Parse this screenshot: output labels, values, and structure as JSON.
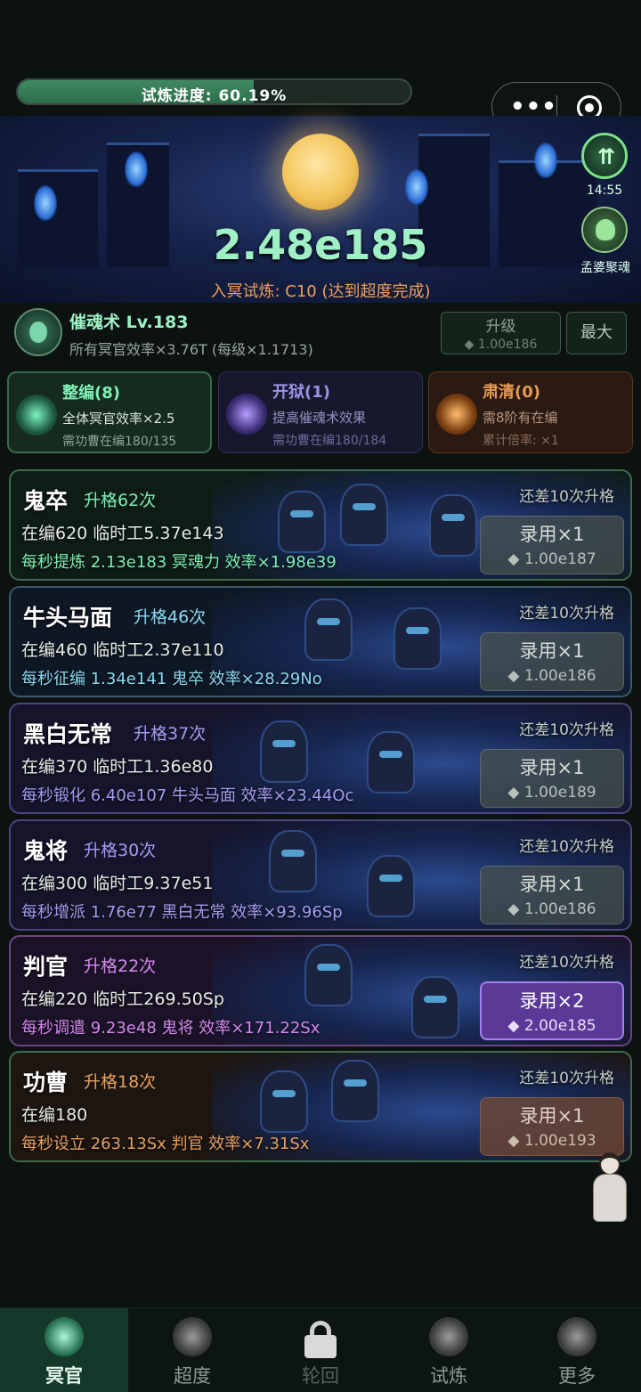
{
  "progress": {
    "label": "试炼进度: 60.19%",
    "value": 0.6019
  },
  "capsule": {
    "more_icon": "•••",
    "close_icon": "target-icon"
  },
  "hero": {
    "amount": "2.48e185",
    "subtitle": "入冥试炼: C10 (达到超度完成)"
  },
  "side": {
    "btn1_icon": "speed-up-icon",
    "timer": "14:55",
    "btn2_icon": "ghost-icon",
    "btn2_label": "孟婆聚魂"
  },
  "skill": {
    "title": "催魂术 Lv.183",
    "desc": "所有冥官效率×3.76T (每级×1.1713)",
    "upgrade_label": "升级",
    "upgrade_cost": "◆ 1.00e186",
    "max_label": "最大"
  },
  "reforms": [
    {
      "title": "整编(8)",
      "line1": "全体冥官效率×2.5",
      "line2": "需功曹在编180/135",
      "color": "#7ff0b4"
    },
    {
      "title": "开狱(1)",
      "line1": "提高催魂术效果",
      "line2": "需功曹在编180/184",
      "color": "#9c93e6"
    },
    {
      "title": "肃清(0)",
      "line1": "需8阶有在编",
      "line2": "累计倍率: ×1",
      "color": "#e89a53"
    }
  ],
  "units": [
    {
      "name": "鬼卒",
      "promo": "升格62次",
      "remain": "还差10次升格",
      "staff": "在编620  临时工5.37e143",
      "prod": "每秒提炼 2.13e183 冥魂力  效率×1.98e39",
      "hire": "录用×1",
      "cost": "◆ 1.00e187"
    },
    {
      "name": "牛头马面",
      "promo": "升格46次",
      "remain": "还差10次升格",
      "staff": "在编460  临时工2.37e110",
      "prod": "每秒征编 1.34e141 鬼卒  效率×28.29No",
      "hire": "录用×1",
      "cost": "◆ 1.00e186"
    },
    {
      "name": "黑白无常",
      "promo": "升格37次",
      "remain": "还差10次升格",
      "staff": "在编370  临时工1.36e80",
      "prod": "每秒锻化 6.40e107 牛头马面  效率×23.44Oc",
      "hire": "录用×1",
      "cost": "◆ 1.00e189"
    },
    {
      "name": "鬼将",
      "promo": "升格30次",
      "remain": "还差10次升格",
      "staff": "在编300  临时工9.37e51",
      "prod": "每秒增派 1.76e77 黑白无常  效率×93.96Sp",
      "hire": "录用×1",
      "cost": "◆ 1.00e186"
    },
    {
      "name": "判官",
      "promo": "升格22次",
      "remain": "还差10次升格",
      "staff": "在编220  临时工269.50Sp",
      "prod": "每秒调遣 9.23e48 鬼将  效率×171.22Sx",
      "hire": "录用×2",
      "cost": "◆ 2.00e185"
    },
    {
      "name": "功曹",
      "promo": "升格18次",
      "remain": "还差10次升格",
      "staff": "在编180",
      "prod": "每秒设立 263.13Sx 判官  效率×7.31Sx",
      "hire": "录用×1",
      "cost": "◆ 1.00e193"
    }
  ],
  "nav": [
    {
      "label": "冥官",
      "icon": "underworld-officer-icon",
      "active": true
    },
    {
      "label": "超度",
      "icon": "salvation-icon"
    },
    {
      "label": "轮回",
      "icon": "lock-icon",
      "locked": true
    },
    {
      "label": "试炼",
      "icon": "trial-icon"
    },
    {
      "label": "更多",
      "icon": "more-icon"
    }
  ]
}
